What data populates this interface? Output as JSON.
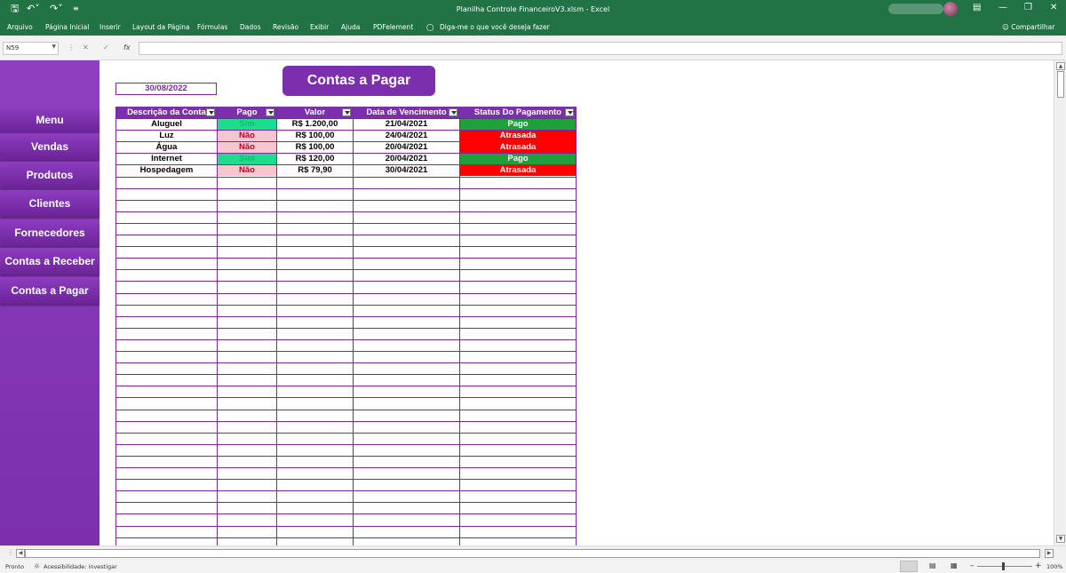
{
  "titlebar": {
    "title": "Planilha Controle FinanceiroV3.xlsm  -  Excel",
    "save_icon": "save-icon",
    "undo_icon": "undo-icon",
    "redo_icon": "redo-icon"
  },
  "ribbon": {
    "tabs": [
      "Arquivo",
      "Página Inicial",
      "Inserir",
      "Layout da Página",
      "Fórmulas",
      "Dados",
      "Revisão",
      "Exibir",
      "Ajuda",
      "PDFelement"
    ],
    "tell_me": "Diga-me o que você deseja fazer",
    "share": "Compartilhar"
  },
  "formula_bar": {
    "name_box": "N59",
    "fx": "fx",
    "formula": ""
  },
  "sheet": {
    "date": "30/08/2022",
    "page_title": "Contas a Pagar",
    "sidebar": [
      "Menu",
      "Vendas",
      "Produtos",
      "Clientes",
      "Fornecedores",
      "Contas a Receber",
      "Contas a Pagar"
    ],
    "table": {
      "headers": [
        "Descrição da Conta",
        "Pago",
        "Valor",
        "Data de Vencimento",
        "Status Do Pagamento"
      ],
      "rows": [
        {
          "descricao": "Aluguel",
          "pago": "Sim",
          "valor": "R$ 1.200,00",
          "vencimento": "21/04/2021",
          "status": "Pago"
        },
        {
          "descricao": "Luz",
          "pago": "Não",
          "valor": "R$ 100,00",
          "vencimento": "24/04/2021",
          "status": "Atrasada"
        },
        {
          "descricao": "Água",
          "pago": "Não",
          "valor": "R$ 100,00",
          "vencimento": "20/04/2021",
          "status": "Atrasada"
        },
        {
          "descricao": "Internet",
          "pago": "Sim",
          "valor": "R$ 120,00",
          "vencimento": "20/04/2021",
          "status": "Pago"
        },
        {
          "descricao": "Hospedagem",
          "pago": "Não",
          "valor": "R$ 79,90",
          "vencimento": "30/04/2021",
          "status": "Atrasada"
        }
      ]
    }
  },
  "colors": {
    "excel_green": "#217346",
    "purple": "#7b2fac",
    "paid_green_cell": "#1ddc8d",
    "unpaid_pink_cell": "#f7c6d0",
    "status_paid": "#1ea13a",
    "status_late": "#ff0000"
  },
  "status_bar": {
    "ready": "Pronto",
    "accessibility": "Acessibilidade: investigar",
    "zoom": "100%"
  }
}
